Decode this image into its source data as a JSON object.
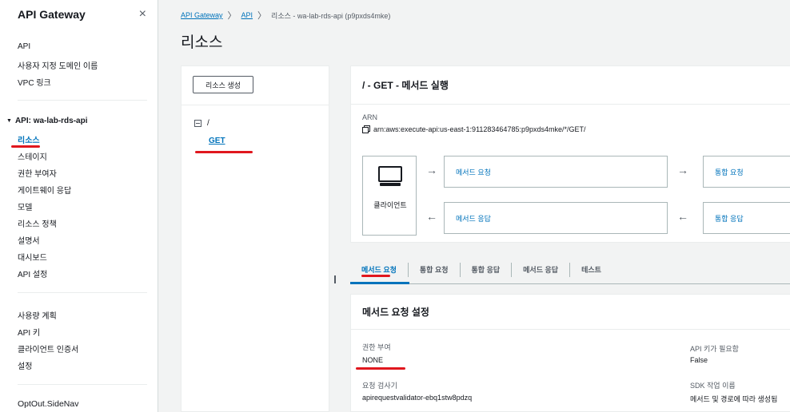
{
  "sidebar": {
    "title": "API Gateway",
    "close_icon": "×",
    "top_links": [
      "API",
      "사용자 지정 도메인 이름",
      "VPC 링크"
    ],
    "api_section": "API: wa-lab-rds-api",
    "api_links": [
      "리소스",
      "스테이지",
      "권한 부여자",
      "게이트웨이 응답",
      "모델",
      "리소스 정책",
      "설명서",
      "대시보드",
      "API 설정"
    ],
    "bottom_links": [
      "사용량 계획",
      "API 키",
      "클라이언트 인증서",
      "설정"
    ],
    "footer_link": "OptOut.SideNav"
  },
  "breadcrumb": {
    "items": [
      "API Gateway",
      "API",
      "리소스 - wa-lab-rds-api (p9pxds4mke)"
    ],
    "separator": "〉"
  },
  "page_title": "리소스",
  "tree": {
    "create_button": "리소스 생성",
    "root": "/",
    "method": "GET"
  },
  "execution": {
    "heading": "/ - GET - 메서드 실행",
    "arn_label": "ARN",
    "arn_value": "arn:aws:execute-api:us-east-1:911283464785:p9pxds4mke/*/GET/",
    "client_label": "클라이언트",
    "method_request": "메서드 요청",
    "integration_request": "통합 요청",
    "method_response": "메서드 응답",
    "integration_response": "통합 응답",
    "arrow_right": "→",
    "arrow_left": "←"
  },
  "tabs": [
    "메서드 요청",
    "통합 요청",
    "통합 응답",
    "메서드 응답",
    "테스트"
  ],
  "settings": {
    "heading": "메서드 요청 설정",
    "authorization_label": "권한 부여",
    "authorization_value": "NONE",
    "validator_label": "요청 검사기",
    "validator_value": "apirequestvalidator-ebq1stw8pdzq",
    "api_key_label": "API 키가 필요함",
    "api_key_value": "False",
    "sdk_label": "SDK 작업 이름",
    "sdk_value": "메서드 및 경로에 따라 생성됨"
  },
  "colors": {
    "link": "#0073bb",
    "annotation_red": "#e0171e",
    "border": "#aab7b8"
  }
}
